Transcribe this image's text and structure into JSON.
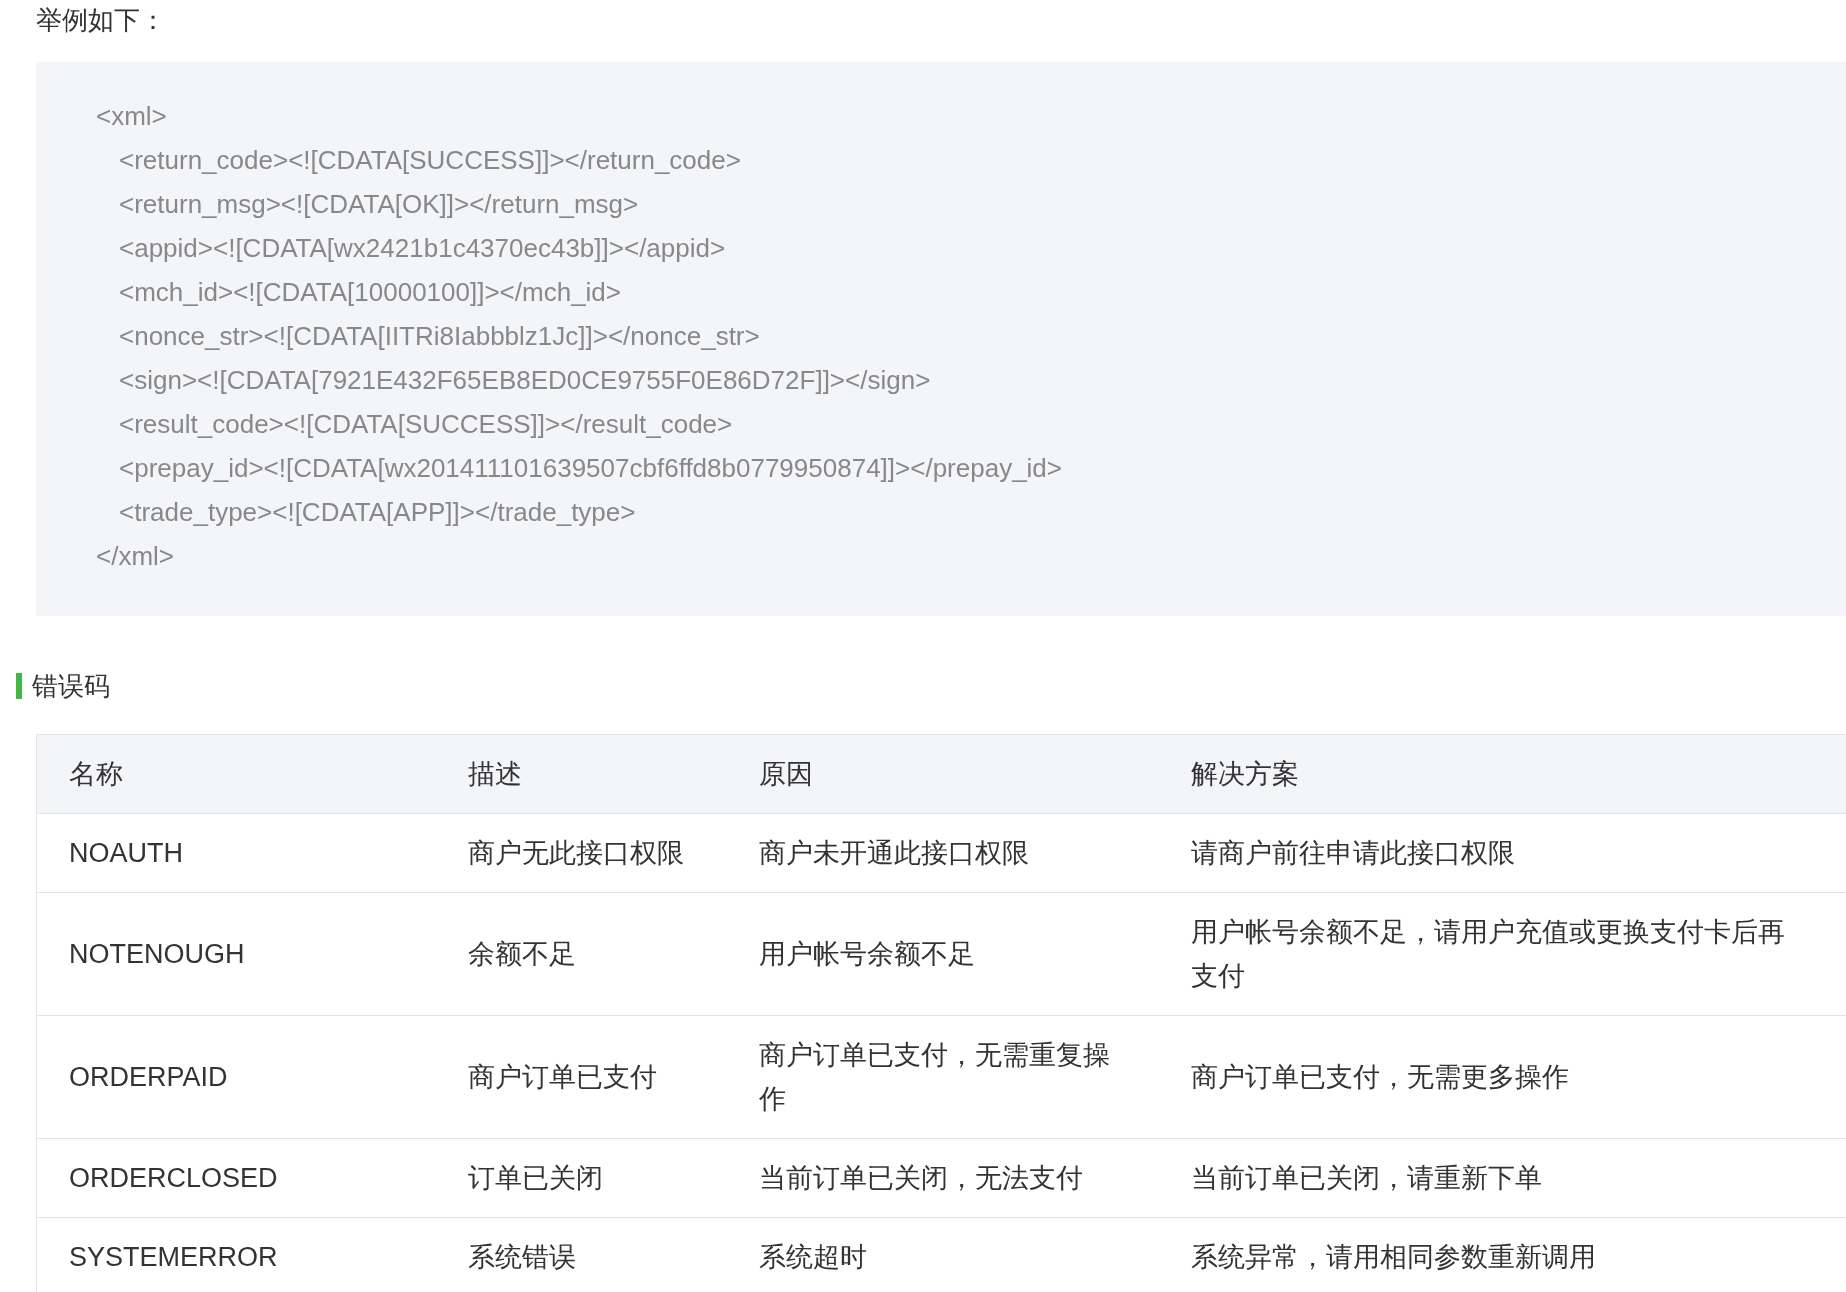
{
  "intro": "举例如下：",
  "code_block": {
    "text": "<xml>",
    "children": [
      {
        "text": "<return_code><![CDATA[SUCCESS]]></return_code>"
      },
      {
        "text": "<return_msg><![CDATA[OK]]></return_msg>"
      },
      {
        "text": "<appid><![CDATA[wx2421b1c4370ec43b]]></appid>"
      },
      {
        "text": "<mch_id><![CDATA[10000100]]></mch_id>"
      },
      {
        "text": "<nonce_str><![CDATA[IITRi8Iabbblz1Jc]]></nonce_str>"
      },
      {
        "text": "<sign><![CDATA[7921E432F65EB8ED0CE9755F0E86D72F]]></sign>"
      },
      {
        "text": "<result_code><![CDATA[SUCCESS]]></result_code>"
      },
      {
        "text": "<prepay_id><![CDATA[wx201411101639507cbf6ffd8b0779950874]]></prepay_id>"
      },
      {
        "text": "<trade_type><![CDATA[APP]]></trade_type>"
      }
    ],
    "closing": "</xml>"
  },
  "section_heading": "错误码",
  "table": {
    "columns": [
      "名称",
      "描述",
      "原因",
      "解决方案"
    ],
    "rows": [
      [
        "NOAUTH",
        "商户无此接口权限",
        "商户未开通此接口权限",
        "请商户前往申请此接口权限"
      ],
      [
        "NOTENOUGH",
        "余额不足",
        "用户帐号余额不足",
        "用户帐号余额不足，请用户充值或更换支付卡后再支付"
      ],
      [
        "ORDERPAID",
        "商户订单已支付",
        "商户订单已支付，无需重复操作",
        "商户订单已支付，无需更多操作"
      ],
      [
        "ORDERCLOSED",
        "订单已关闭",
        "当前订单已关闭，无法支付",
        "当前订单已关闭，请重新下单"
      ],
      [
        "SYSTEMERROR",
        "系统错误",
        "系统超时",
        "系统异常，请用相同参数重新调用"
      ]
    ]
  }
}
